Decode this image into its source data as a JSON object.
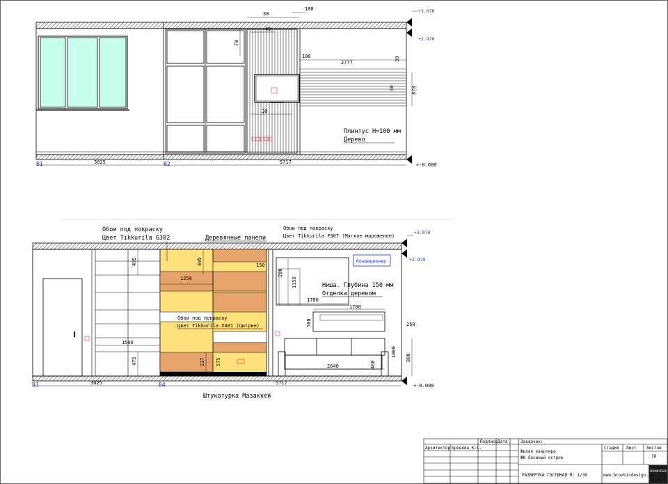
{
  "colors": {
    "window_glass": "#c7ffef",
    "yellow_panel": "#ffe07a",
    "light_yellow": "#fff0b8",
    "wood_panel": "#e6a46a",
    "level_blue": "#1a2fb0",
    "hatch": "#000000"
  },
  "elevation_top": {
    "axis_start": "В1",
    "axis_mid": "В2",
    "dim_width_left": "3025",
    "dim_width_right": "5717",
    "levels": {
      "top": "+3.070",
      "ceiling": "+2.970",
      "floor": "+-0.000"
    },
    "dims": {
      "d100": "100",
      "d30a": "30",
      "d40": "40",
      "d70": "70",
      "d180": "180",
      "d2777": "2777",
      "d30b": "30",
      "d40b": "40",
      "d870": "870",
      "d30c": "30"
    },
    "notes": {
      "line1": "Плинтус H=100 мм",
      "line2": "Дерево"
    }
  },
  "elevation_bottom": {
    "axis_start": "В3",
    "axis_mid": "В4",
    "dim_width_left": "3025",
    "dim_width_right": "5717",
    "levels": {
      "top": "+3.070",
      "ceiling": "+2.970",
      "floor": "+-0.000"
    },
    "callouts": {
      "wallpaper_g302_line1": "Обои под покраску",
      "wallpaper_g302_line2": "Цвет Tikkurila G302",
      "wood_panels": "Деревянные панели",
      "wallpaper_f307_line1": "Обои под покраску",
      "wallpaper_f307_line2": "Цвет Tikkurila F307 (Мягкое мороженое)",
      "conditioner": "Кондиционер",
      "niche_line1": "Ниша. Глубина 150 мм",
      "niche_line2": "Отделка деревом",
      "wallpaper_x401_line1": "Обои под покраску",
      "wallpaper_x401_line2": "Цвет Tikkurila X401 (Цитрин)",
      "bottom_label": "Штукатурка Мазаккей"
    },
    "dims": {
      "d495a": "495",
      "d495b": "495",
      "d150": "150",
      "d1250": "1250",
      "d200": "200",
      "d1150": "1150",
      "d1700a": "1700",
      "d1700b": "1700",
      "d500": "500",
      "d250": "250",
      "d1500": "1500",
      "d475": "475",
      "d237": "237",
      "d575": "575",
      "d2640": "2640",
      "d460": "460",
      "d1000": "1000",
      "d880": "880"
    }
  },
  "title_block": {
    "col_sign": "Подпись",
    "col_date": "Дата",
    "customer_label": "Заказчик:",
    "role": "Архитектор",
    "person": "Бровкин К.С.",
    "project_line1": "Жилая квартира",
    "project_line2": "ЖК Лосиный остров",
    "col_stage": "Стадия",
    "col_sheet": "Лист",
    "col_sheets": "Листов",
    "sheet_number": "18",
    "sheet_title": "РАЗВЕРТКА ГОСТИНАЯ М: 1/30",
    "website": "www.brovkindesign.ru",
    "logo_text": "BROVKIN DESIGN"
  }
}
